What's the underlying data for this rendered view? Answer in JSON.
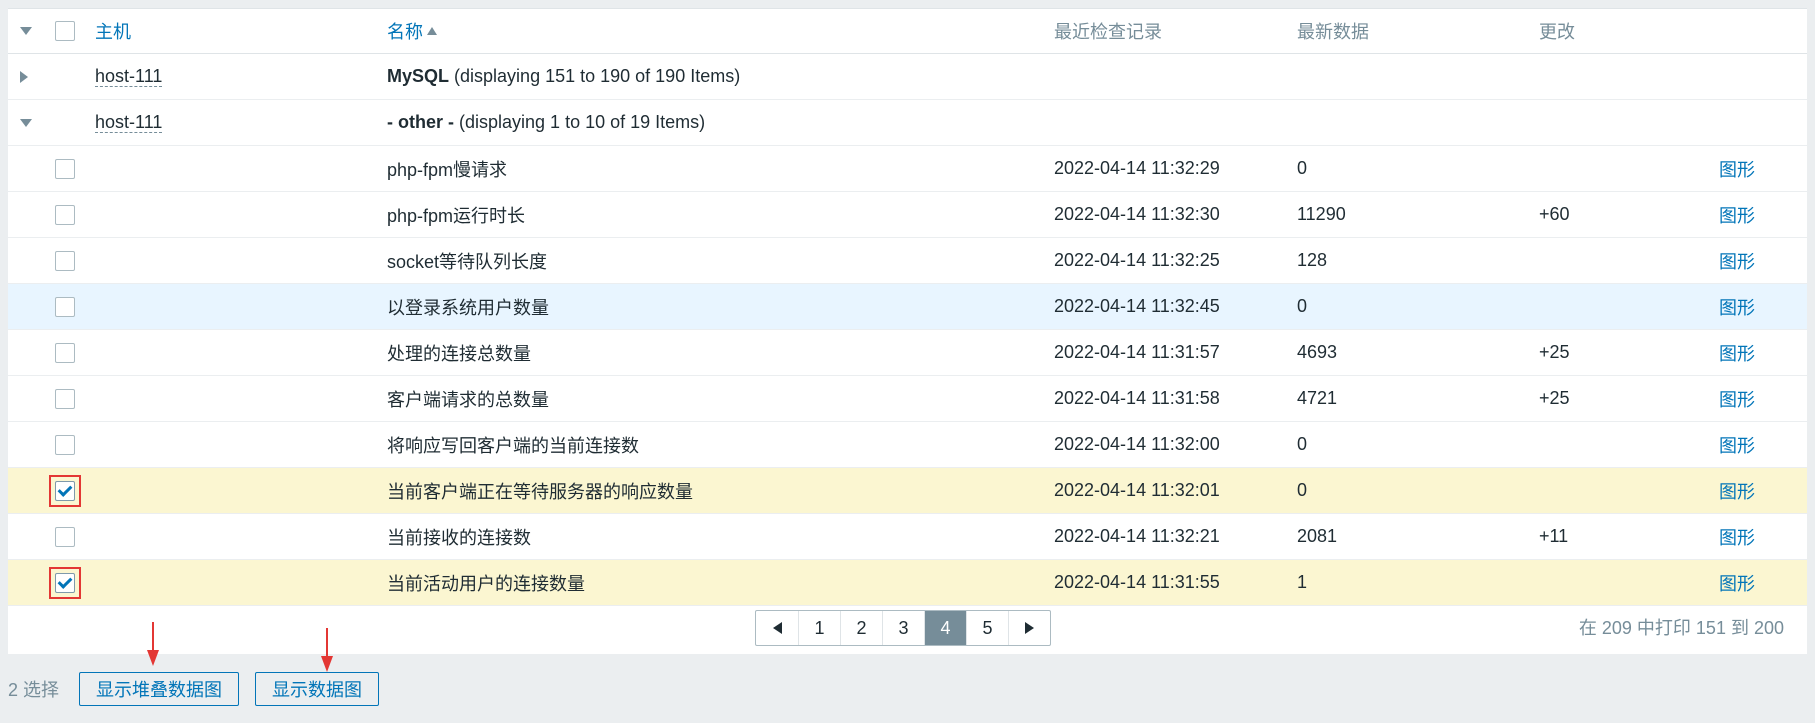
{
  "header": {
    "host": "主机",
    "name": "名称",
    "last_check": "最近检查记录",
    "last_value": "最新数据",
    "change": "更改"
  },
  "groups": [
    {
      "host": "host-111",
      "name": "MySQL",
      "detail": "(displaying 151 to 190 of 190 Items)",
      "expanded": false
    },
    {
      "host": "host-111",
      "name": "- other -",
      "detail": "(displaying 1 to 10 of 19 Items)",
      "expanded": true
    }
  ],
  "items": [
    {
      "name": "php-fpm慢请求",
      "time": "2022-04-14 11:32:29",
      "value": "0",
      "change": "",
      "graph": "图形",
      "checked": false
    },
    {
      "name": "php-fpm运行时长",
      "time": "2022-04-14 11:32:30",
      "value": "11290",
      "change": "+60",
      "graph": "图形",
      "checked": false
    },
    {
      "name": "socket等待队列长度",
      "time": "2022-04-14 11:32:25",
      "value": "128",
      "change": "",
      "graph": "图形",
      "checked": false
    },
    {
      "name": "以登录系统用户数量",
      "time": "2022-04-14 11:32:45",
      "value": "0",
      "change": "",
      "graph": "图形",
      "checked": false
    },
    {
      "name": "处理的连接总数量",
      "time": "2022-04-14 11:31:57",
      "value": "4693",
      "change": "+25",
      "graph": "图形",
      "checked": false
    },
    {
      "name": "客户端请求的总数量",
      "time": "2022-04-14 11:31:58",
      "value": "4721",
      "change": "+25",
      "graph": "图形",
      "checked": false
    },
    {
      "name": "将响应写回客户端的当前连接数",
      "time": "2022-04-14 11:32:00",
      "value": "0",
      "change": "",
      "graph": "图形",
      "checked": false
    },
    {
      "name": "当前客户端正在等待服务器的响应数量",
      "time": "2022-04-14 11:32:01",
      "value": "0",
      "change": "",
      "graph": "图形",
      "checked": true
    },
    {
      "name": "当前接收的连接数",
      "time": "2022-04-14 11:32:21",
      "value": "2081",
      "change": "+11",
      "graph": "图形",
      "checked": false
    },
    {
      "name": "当前活动用户的连接数量",
      "time": "2022-04-14 11:31:55",
      "value": "1",
      "change": "",
      "graph": "图形",
      "checked": true
    }
  ],
  "pagination": {
    "pages": [
      "1",
      "2",
      "3",
      "4",
      "5"
    ],
    "current": "4"
  },
  "stats": "在 209 中打印 151 到 200",
  "footer": {
    "selected": "2 选择",
    "stacked_graph": "显示堆叠数据图",
    "graph": "显示数据图"
  },
  "colors": {
    "link": "#0275b8",
    "selected_row": "#fbf6d1",
    "hover_row": "#e8f5ff",
    "annotation_red": "#e33734"
  }
}
